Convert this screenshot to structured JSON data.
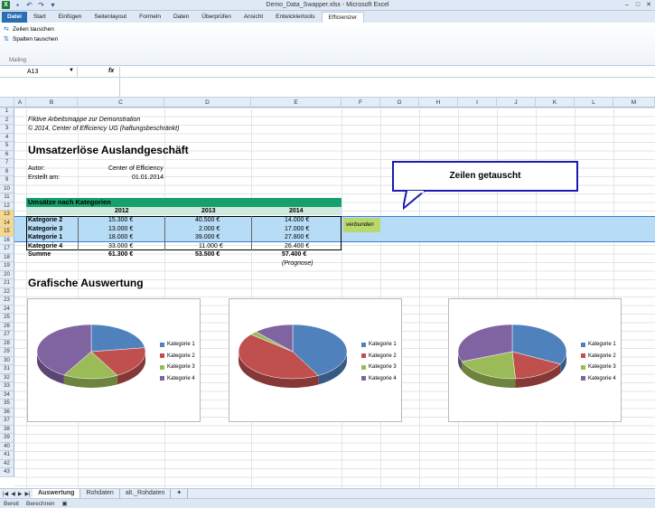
{
  "window": {
    "title": "Demo_Data_Swapper.xlsx - Microsoft Excel"
  },
  "ribbon": {
    "tabs": [
      "Datei",
      "Start",
      "Einfügen",
      "Seitenlayout",
      "Formeln",
      "Daten",
      "Überprüfen",
      "Ansicht",
      "Entwicklertools",
      "Efficienizer"
    ],
    "buttons": {
      "rows": "Zeilen tauschen",
      "cols": "Spalten tauschen"
    },
    "group": "Mailing"
  },
  "formula": {
    "namebox": "A13",
    "fx": "fx",
    "value": ""
  },
  "columns": [
    "A",
    "B",
    "C",
    "D",
    "E",
    "F",
    "G",
    "H",
    "I",
    "J",
    "K",
    "L",
    "M"
  ],
  "rows": [
    "1",
    "2",
    "3",
    "4",
    "5",
    "6",
    "7",
    "8",
    "9",
    "10",
    "11",
    "12",
    "13",
    "14",
    "15",
    "16",
    "17",
    "18",
    "19",
    "20",
    "21",
    "22",
    "23",
    "24",
    "25",
    "26",
    "27",
    "28",
    "29",
    "30",
    "31",
    "32",
    "33",
    "34",
    "35",
    "36",
    "37",
    "38",
    "39",
    "40",
    "41",
    "42",
    "43"
  ],
  "sheet": {
    "line1": "Fiktive Arbeitsmappe zur Demonstration",
    "line2": "© 2014, Center of Efficiency UG (haftungsbeschränkt)",
    "heading": "Umsatzerlöse Auslandgeschäft",
    "author_label": "Autor:",
    "author_value": "Center of Efficiency",
    "created_label": "Erstellt am:",
    "created_value": "01.01.2014",
    "table_title": "Umsätze nach Kategorien",
    "years": [
      "2012",
      "2013",
      "2014"
    ],
    "table_rows": [
      {
        "label": "Kategorie 2",
        "v": [
          "15.300 €",
          "40.500 €",
          "14.000 €"
        ]
      },
      {
        "label": "Kategorie 3",
        "v": [
          "13.000 €",
          "2.000 €",
          "17.000 €"
        ]
      },
      {
        "label": "Kategorie 1",
        "v": [
          "18.000 €",
          "39.000 €",
          "27.800 €"
        ]
      },
      {
        "label": "Kategorie 4",
        "v": [
          "33.000 €",
          "11.000 €",
          "26.400 €"
        ]
      }
    ],
    "sum_label": "Summe",
    "sums": [
      "61.300 €",
      "53.500 €",
      "57.400 €"
    ],
    "prognose": "(Prognose)",
    "verbunden": "verbunden",
    "callout": "Zeilen getauscht",
    "charts_heading": "Grafische Auswertung"
  },
  "chart_data": [
    {
      "type": "pie",
      "categories": [
        "Kategorie 1",
        "Kategorie 2",
        "Kategorie 3",
        "Kategorie 4"
      ],
      "values": [
        18000,
        15300,
        13000,
        33000
      ],
      "colors": [
        "#4f81bd",
        "#c0504d",
        "#9bbb59",
        "#8064a2"
      ]
    },
    {
      "type": "pie",
      "categories": [
        "Kategorie 1",
        "Kategorie 2",
        "Kategorie 3",
        "Kategorie 4"
      ],
      "values": [
        39000,
        40500,
        2000,
        11000
      ],
      "colors": [
        "#4f81bd",
        "#c0504d",
        "#9bbb59",
        "#8064a2"
      ]
    },
    {
      "type": "pie",
      "categories": [
        "Kategorie 1",
        "Kategorie 2",
        "Kategorie 3",
        "Kategorie 4"
      ],
      "values": [
        27800,
        14000,
        17000,
        26400
      ],
      "colors": [
        "#4f81bd",
        "#c0504d",
        "#9bbb59",
        "#8064a2"
      ]
    }
  ],
  "sheet_tabs": [
    "Auswertung",
    "Rohdaten",
    "alt._Rohdaten"
  ],
  "status": [
    "Bereit",
    "Berechnen"
  ]
}
